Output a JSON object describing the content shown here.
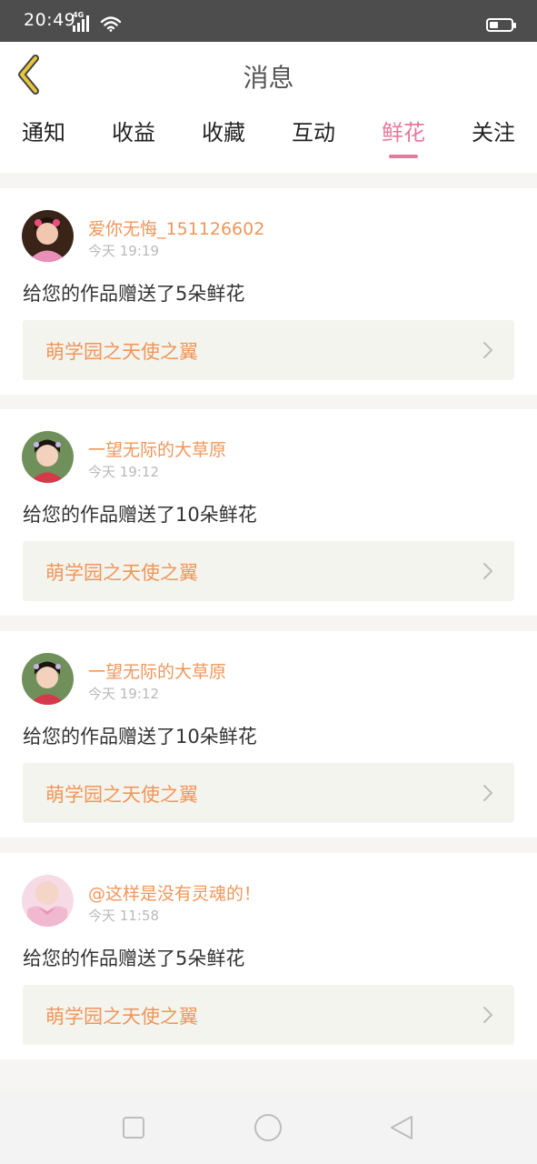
{
  "status_bar": {
    "time": "20:49",
    "network": "4G",
    "battery_level": 0.4
  },
  "header": {
    "title": "消息",
    "back_icon": "back-chevron-icon",
    "accent_color": "#e9c63a"
  },
  "tabs": [
    {
      "label": "通知",
      "active": false
    },
    {
      "label": "收益",
      "active": false
    },
    {
      "label": "收藏",
      "active": false
    },
    {
      "label": "互动",
      "active": false
    },
    {
      "label": "鲜花",
      "active": true
    },
    {
      "label": "关注",
      "active": false
    }
  ],
  "colors": {
    "active_tab": "#e9789c",
    "name": "#f0965a",
    "link_bg": "#f4f4ee"
  },
  "messages": [
    {
      "user": "爱你无悔_151126602",
      "time": "今天 19:19",
      "text": "给您的作品赠送了5朵鲜花",
      "work": "萌学园之天使之翼"
    },
    {
      "user": "一望无际的大草原",
      "time": "今天 19:12",
      "text": "给您的作品赠送了10朵鲜花",
      "work": "萌学园之天使之翼"
    },
    {
      "user": "一望无际的大草原",
      "time": "今天 19:12",
      "text": "给您的作品赠送了10朵鲜花",
      "work": "萌学园之天使之翼"
    },
    {
      "user": "@这样是没有灵魂的！",
      "time": "今天 11:58",
      "text": "给您的作品赠送了5朵鲜花",
      "work": "萌学园之天使之翼"
    }
  ],
  "nav_bar": {
    "buttons": [
      "recent-apps-square-icon",
      "home-circle-icon",
      "back-triangle-icon"
    ]
  }
}
